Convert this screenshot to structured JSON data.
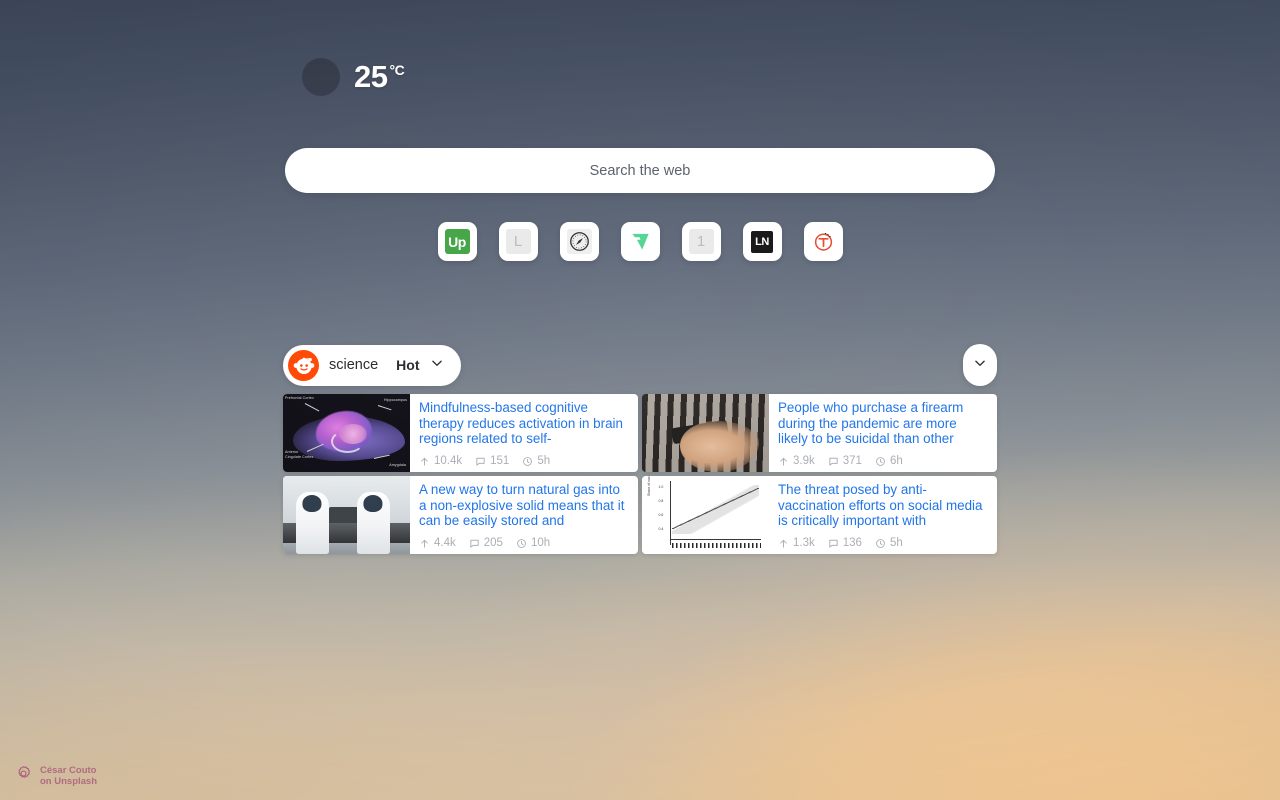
{
  "weather": {
    "temperature": "25",
    "unit": "°C",
    "icon": "weather-placeholder-icon"
  },
  "search": {
    "placeholder": "Search the web",
    "value": ""
  },
  "shortcuts": [
    {
      "name": "shortcut-upwork",
      "label": "Up",
      "icon": "upwork-icon"
    },
    {
      "name": "shortcut-l",
      "label": "L",
      "icon": "letter-l-icon"
    },
    {
      "name": "shortcut-safari",
      "label": "",
      "icon": "compass-icon"
    },
    {
      "name": "shortcut-flowcv",
      "label": "",
      "icon": "flowcv-icon"
    },
    {
      "name": "shortcut-one",
      "label": "1",
      "icon": "number-one-icon"
    },
    {
      "name": "shortcut-ln",
      "label": "LN",
      "icon": "ln-logo-icon"
    },
    {
      "name": "shortcut-t",
      "label": "T",
      "icon": "t-circle-icon"
    }
  ],
  "reddit": {
    "logo_icon": "reddit-icon",
    "subreddit": "science",
    "sort": "Hot",
    "sort_chevron_icon": "chevron-down-icon",
    "expand_icon": "chevron-down-icon",
    "posts": [
      {
        "title": "Mindfulness-based cognitive therapy reduces activation in brain regions related to self-",
        "upvotes": "10.4k",
        "comments": "151",
        "age": "5h",
        "thumbnail": "brain-diagram"
      },
      {
        "title": "People who purchase a firearm during the pandemic are more likely to be suicidal than other",
        "upvotes": "3.9k",
        "comments": "371",
        "age": "6h",
        "thumbnail": "gun-rack-photo"
      },
      {
        "title": "A new way to turn natural gas into a non-explosive solid means that it can be easily stored and",
        "upvotes": "4.4k",
        "comments": "205",
        "age": "10h",
        "thumbnail": "lab-researchers-photo"
      },
      {
        "title": "The threat posed by anti-vaccination efforts on social media is critically important with",
        "upvotes": "1.3k",
        "comments": "136",
        "age": "5h",
        "thumbnail": "line-chart"
      }
    ]
  },
  "attribution": {
    "line1": "César Couto",
    "line2": "on Unsplash",
    "settings_icon": "gear-icon"
  },
  "colors": {
    "accent_link": "#1b72e8",
    "reddit_orange": "#ff4500",
    "upwork_green": "#3fa341",
    "flowcv_green": "#4fd392",
    "attribution_pink": "#b1637f",
    "bg_top": "#3b4557",
    "bg_bottom": "#eed6ab"
  }
}
